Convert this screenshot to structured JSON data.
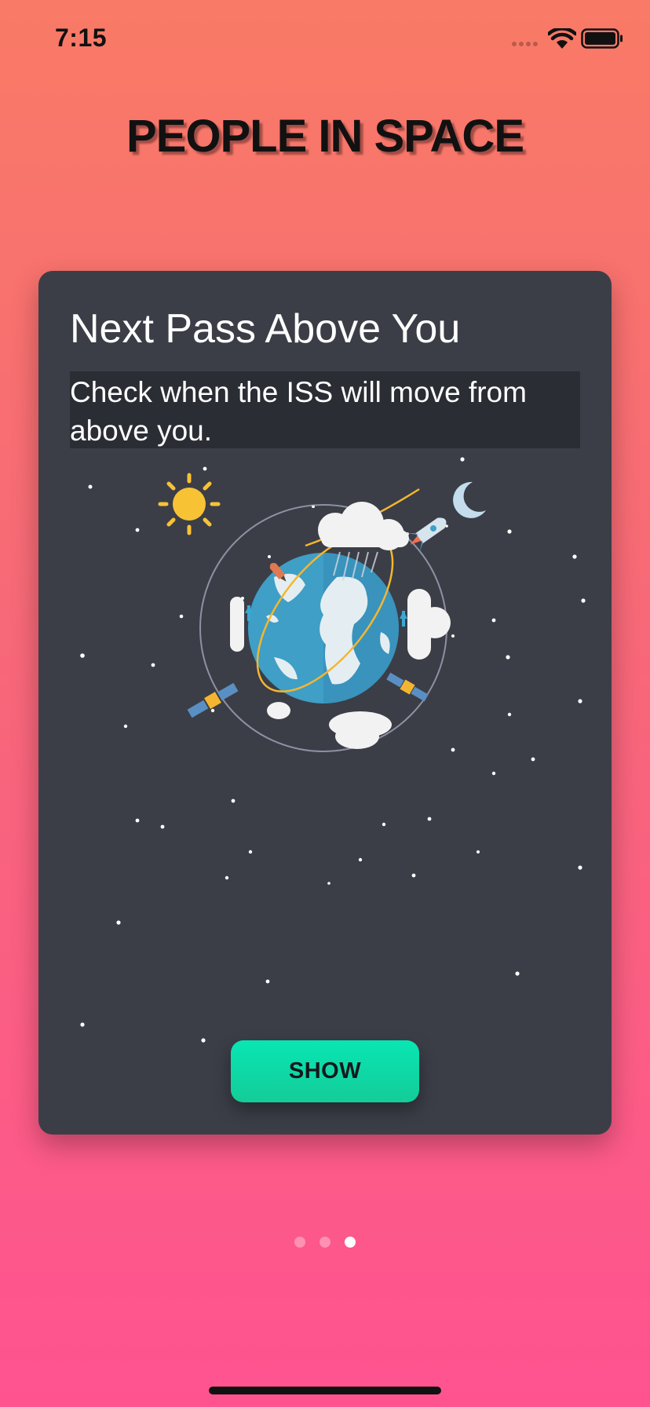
{
  "status_bar": {
    "time": "7:15"
  },
  "app": {
    "title": "PEOPLE IN SPACE"
  },
  "card": {
    "title": "Next Pass Above You",
    "description": "Check when the ISS will move from above you.",
    "button_label": "SHOW",
    "illustration_icon": "earth-orbit-illustration"
  },
  "pager": {
    "page_count": 3,
    "active_index": 2
  },
  "colors": {
    "background_top": "#f97a66",
    "background_bottom": "#ff5390",
    "card_background": "#3b3e47",
    "button": "#0adfae",
    "title_text": "#111111"
  }
}
